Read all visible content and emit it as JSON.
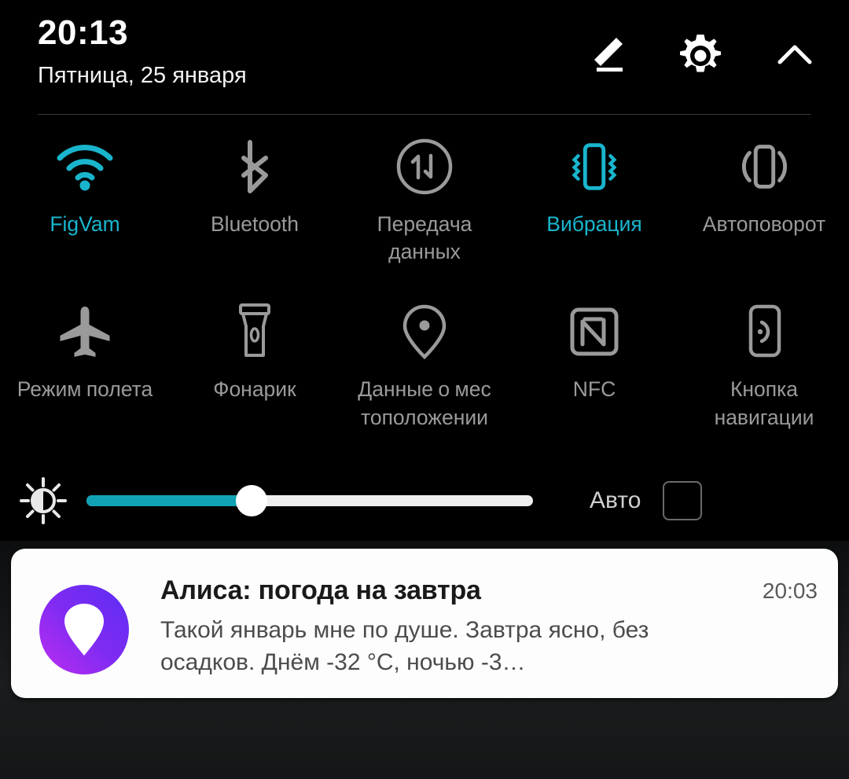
{
  "status": {
    "clock": "20:13",
    "date": "Пятница, 25 января"
  },
  "header_actions": [
    {
      "name": "edit-icon",
      "label": "Изменить"
    },
    {
      "name": "gear-icon",
      "label": "Настройки"
    },
    {
      "name": "chevron-up-icon",
      "label": "Свернуть"
    }
  ],
  "tiles": {
    "row1": [
      {
        "id": "wifi",
        "label": "FigVam",
        "icon": "wifi-icon",
        "active": true
      },
      {
        "id": "bluetooth",
        "label": "Bluetooth",
        "icon": "bluetooth-icon",
        "active": false
      },
      {
        "id": "mobiledata",
        "label": "Передача данных",
        "icon": "data-transfer-icon",
        "active": false
      },
      {
        "id": "vibration",
        "label": "Вибрация",
        "icon": "vibration-icon",
        "active": true
      },
      {
        "id": "autorotate",
        "label": "Автоповорот",
        "icon": "auto-rotate-icon",
        "active": false
      }
    ],
    "row2": [
      {
        "id": "airplane",
        "label": "Режим полета",
        "icon": "airplane-icon",
        "active": false
      },
      {
        "id": "flashlight",
        "label": "Фонарик",
        "icon": "flashlight-icon",
        "active": false
      },
      {
        "id": "location",
        "label": "Данные о мес тоположении",
        "icon": "location-pin-icon",
        "active": false
      },
      {
        "id": "nfc",
        "label": "NFC",
        "icon": "nfc-icon",
        "active": false
      },
      {
        "id": "navbutton",
        "label": "Кнопка навигации",
        "icon": "nav-button-icon",
        "active": false
      }
    ]
  },
  "brightness": {
    "icon": "brightness-icon",
    "value_percent": 37,
    "auto_label": "Авто",
    "auto_checked": false
  },
  "notification": {
    "app_icon": "alice-assistant-icon",
    "title": "Алиса: погода на завтра",
    "time": "20:03",
    "body": "Такой январь мне по душе. Завтра ясно, без осадков. Днём -32 °C, ночью -3…"
  },
  "colors": {
    "accent_cyan": "#19b5cd",
    "slider_fill": "#12a2b6",
    "inactive_gray": "#9a9a9a",
    "background": "#000000",
    "alice_gradient_start": "#6a2bf0",
    "alice_gradient_end": "#b02ef0"
  }
}
